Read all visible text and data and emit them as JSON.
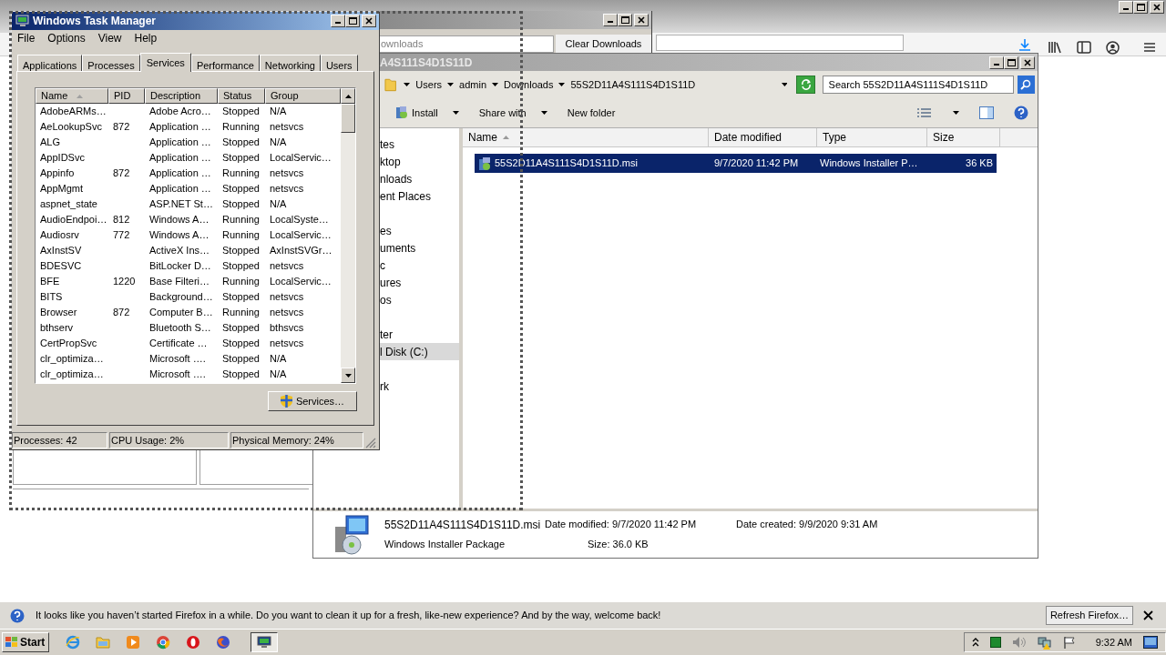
{
  "downloads_window": {
    "search": {
      "placeholder": "ownloads"
    },
    "clear_button": "Clear Downloads"
  },
  "explorer": {
    "title": "A4S111S4D1S11D",
    "breadcrumb": [
      "Users",
      "admin",
      "Downloads",
      "55S2D11A4S111S4D1S11D"
    ],
    "search": {
      "placeholder": "Search 55S2D11A4S111S4D1S11D"
    },
    "toolbar": [
      {
        "label": "Install",
        "dropdown": true
      },
      {
        "label": "Share with",
        "dropdown": true
      },
      {
        "label": "New folder",
        "dropdown": false
      }
    ],
    "nav_groups": [
      [
        {
          "label": "tes",
          "selected": false
        },
        {
          "label": "ktop",
          "selected": false
        },
        {
          "label": "nloads",
          "selected": false
        },
        {
          "label": "ent Places",
          "selected": false
        }
      ],
      [
        {
          "label": "es",
          "selected": false
        },
        {
          "label": "uments",
          "selected": false
        },
        {
          "label": "c",
          "selected": false
        },
        {
          "label": "ures",
          "selected": false
        },
        {
          "label": "os",
          "selected": false
        }
      ],
      [
        {
          "label": "ter",
          "selected": false
        },
        {
          "label": "l Disk (C:)",
          "selected": true
        }
      ],
      [
        {
          "label": "rk",
          "selected": false
        }
      ]
    ],
    "columns": [
      "Name",
      "Date modified",
      "Type",
      "Size"
    ],
    "files": [
      {
        "name": "55S2D11A4S111S4D1S11D.msi",
        "date_modified": "9/7/2020 11:42 PM",
        "type": "Windows Installer P…",
        "size": "36 KB",
        "selected": true
      }
    ],
    "details": {
      "name": "55S2D11A4S111S4D1S11D.msi",
      "type": "Windows Installer Package",
      "date_modified": "Date modified: 9/7/2020 11:42 PM",
      "size": "Size: 36.0 KB",
      "date_created": "Date created: 9/9/2020 9:31 AM"
    }
  },
  "task_manager": {
    "title": "Windows Task Manager",
    "menu": [
      "File",
      "Options",
      "View",
      "Help"
    ],
    "tabs": [
      {
        "label": "Applications",
        "selected": false
      },
      {
        "label": "Processes",
        "selected": false
      },
      {
        "label": "Services",
        "selected": true
      },
      {
        "label": "Performance",
        "selected": false
      },
      {
        "label": "Networking",
        "selected": false
      },
      {
        "label": "Users",
        "selected": false
      }
    ],
    "columns": [
      {
        "label": "Name",
        "sorted": true
      },
      {
        "label": "PID",
        "sorted": false
      },
      {
        "label": "Description",
        "sorted": false
      },
      {
        "label": "Status",
        "sorted": false
      },
      {
        "label": "Group",
        "sorted": false
      }
    ],
    "rows": [
      [
        "AdobeARMs…",
        "",
        "Adobe Acro…",
        "Stopped",
        "N/A"
      ],
      [
        "AeLookupSvc",
        "872",
        "Application …",
        "Running",
        "netsvcs"
      ],
      [
        "ALG",
        "",
        "Application …",
        "Stopped",
        "N/A"
      ],
      [
        "AppIDSvc",
        "",
        "Application …",
        "Stopped",
        "LocalServic…"
      ],
      [
        "Appinfo",
        "872",
        "Application …",
        "Running",
        "netsvcs"
      ],
      [
        "AppMgmt",
        "",
        "Application …",
        "Stopped",
        "netsvcs"
      ],
      [
        "aspnet_state",
        "",
        "ASP.NET St…",
        "Stopped",
        "N/A"
      ],
      [
        "AudioEndpoi…",
        "812",
        "Windows A…",
        "Running",
        "LocalSyste…"
      ],
      [
        "Audiosrv",
        "772",
        "Windows A…",
        "Running",
        "LocalServic…"
      ],
      [
        "AxInstSV",
        "",
        "ActiveX Ins…",
        "Stopped",
        "AxInstSVGr…"
      ],
      [
        "BDESVC",
        "",
        "BitLocker D…",
        "Stopped",
        "netsvcs"
      ],
      [
        "BFE",
        "1220",
        "Base Filteri…",
        "Running",
        "LocalServic…"
      ],
      [
        "BITS",
        "",
        "Background…",
        "Stopped",
        "netsvcs"
      ],
      [
        "Browser",
        "872",
        "Computer B…",
        "Running",
        "netsvcs"
      ],
      [
        "bthserv",
        "",
        "Bluetooth S…",
        "Stopped",
        "bthsvcs"
      ],
      [
        "CertPropSvc",
        "",
        "Certificate …",
        "Stopped",
        "netsvcs"
      ],
      [
        "clr_optimiza…",
        "",
        "Microsoft ….",
        "Stopped",
        "N/A"
      ],
      [
        "clr_optimiza…",
        "",
        "Microsoft ….",
        "Stopped",
        "N/A"
      ]
    ],
    "services_button": "Services…",
    "status_bar": [
      "Processes: 42",
      "CPU Usage: 2%",
      "Physical Memory: 24%"
    ]
  },
  "notification": {
    "message": "It looks like you haven’t started Firefox in a while. Do you want to clean it up for a fresh, like-new experience? And by the way, welcome back!",
    "button": "Refresh Firefox…"
  },
  "taskbar": {
    "start": "Start",
    "apps": [
      {
        "kind": "ie",
        "active": false
      },
      {
        "kind": "folder",
        "active": false
      },
      {
        "kind": "media",
        "active": false
      },
      {
        "kind": "chrome",
        "active": false
      },
      {
        "kind": "opera",
        "active": false
      },
      {
        "kind": "firefox",
        "active": false
      },
      {
        "kind": "monitor",
        "active": true
      }
    ],
    "clock": "9:32 AM"
  }
}
